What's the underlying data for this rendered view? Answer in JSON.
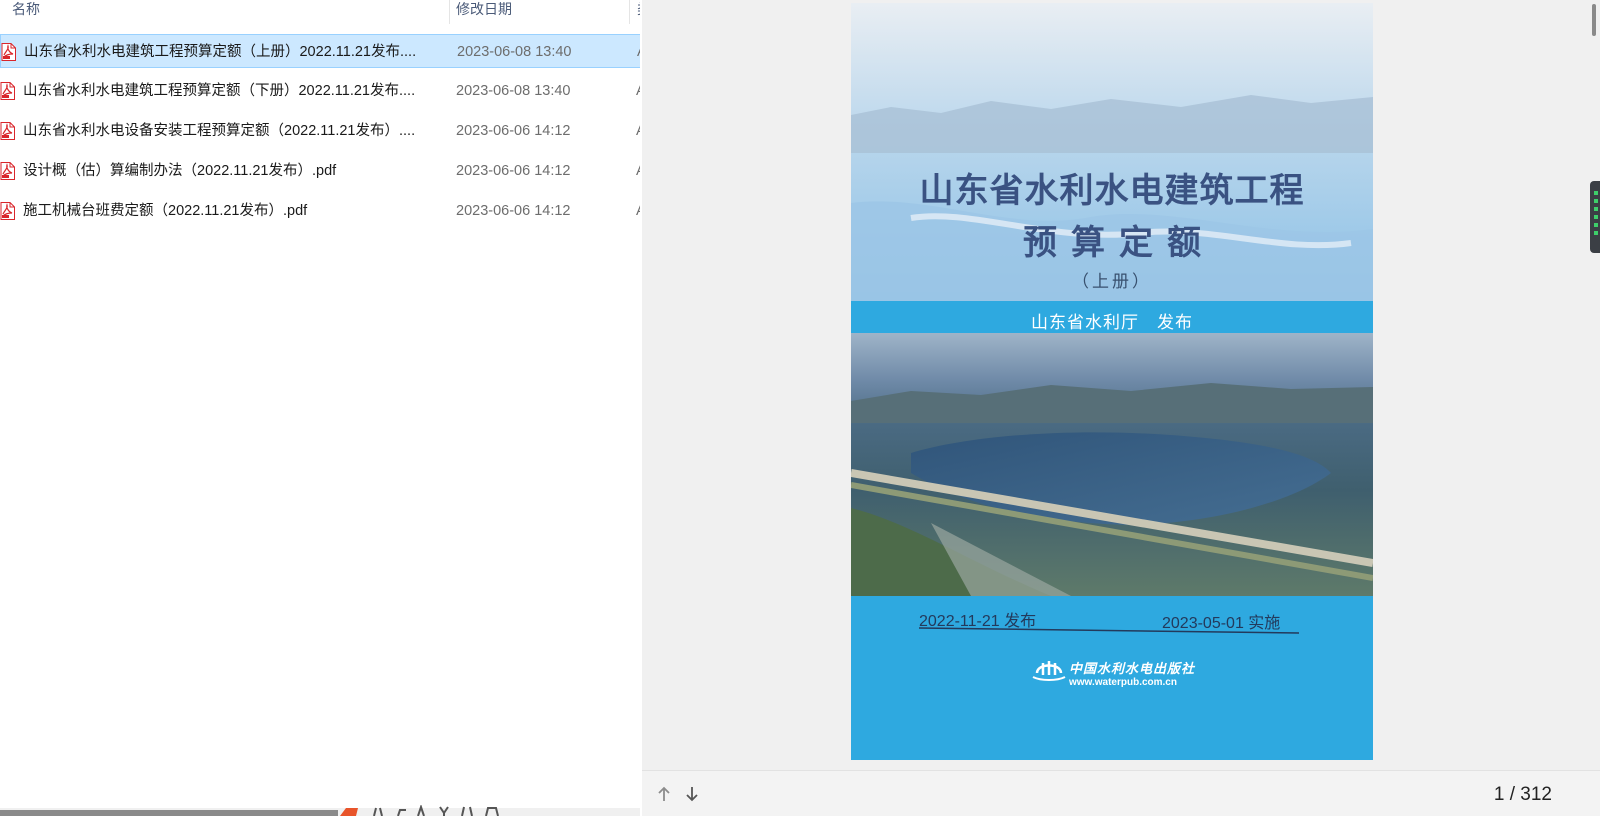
{
  "file_list": {
    "columns": {
      "name": "名称",
      "date": "修改日期",
      "type": "类型"
    },
    "files": [
      {
        "name": "山东省水利水电建筑工程预算定额（上册）2022.11.21发布....",
        "date": "2023-06-08 13:40",
        "type": "A",
        "icon": "pdf-file-icon",
        "selected": true
      },
      {
        "name": "山东省水利水电建筑工程预算定额（下册）2022.11.21发布....",
        "date": "2023-06-08 13:40",
        "type": "A",
        "icon": "pdf-file-icon",
        "selected": false
      },
      {
        "name": "山东省水利水电设备安装工程预算定额（2022.11.21发布）....",
        "date": "2023-06-06 14:12",
        "type": "A",
        "icon": "pdf-file-icon",
        "selected": false
      },
      {
        "name": "设计概（估）算编制办法（2022.11.21发布）.pdf",
        "date": "2023-06-06 14:12",
        "type": "A",
        "icon": "pdf-file-icon",
        "selected": false
      },
      {
        "name": "施工机械台班费定额（2022.11.21发布）.pdf",
        "date": "2023-06-06 14:12",
        "type": "A",
        "icon": "pdf-file-icon",
        "selected": false
      }
    ]
  },
  "preview": {
    "cover": {
      "title_line1": "山东省水利水电建筑工程",
      "title_line2": "预算定额",
      "volume": "（上册）",
      "publisher": "山东省水利厅　发布",
      "issued": "2022-11-21 发布",
      "effective": "2023-05-01 实施",
      "press_name": "中国水利水电出版社",
      "press_url": "www.waterpub.com.cn"
    },
    "page_indicator": "1 / 312"
  },
  "colors": {
    "selection": "#cce8ff",
    "cover_band": "#2ea9e0",
    "cover_title": "#3a5282",
    "pdf_red": "#d9262b"
  }
}
